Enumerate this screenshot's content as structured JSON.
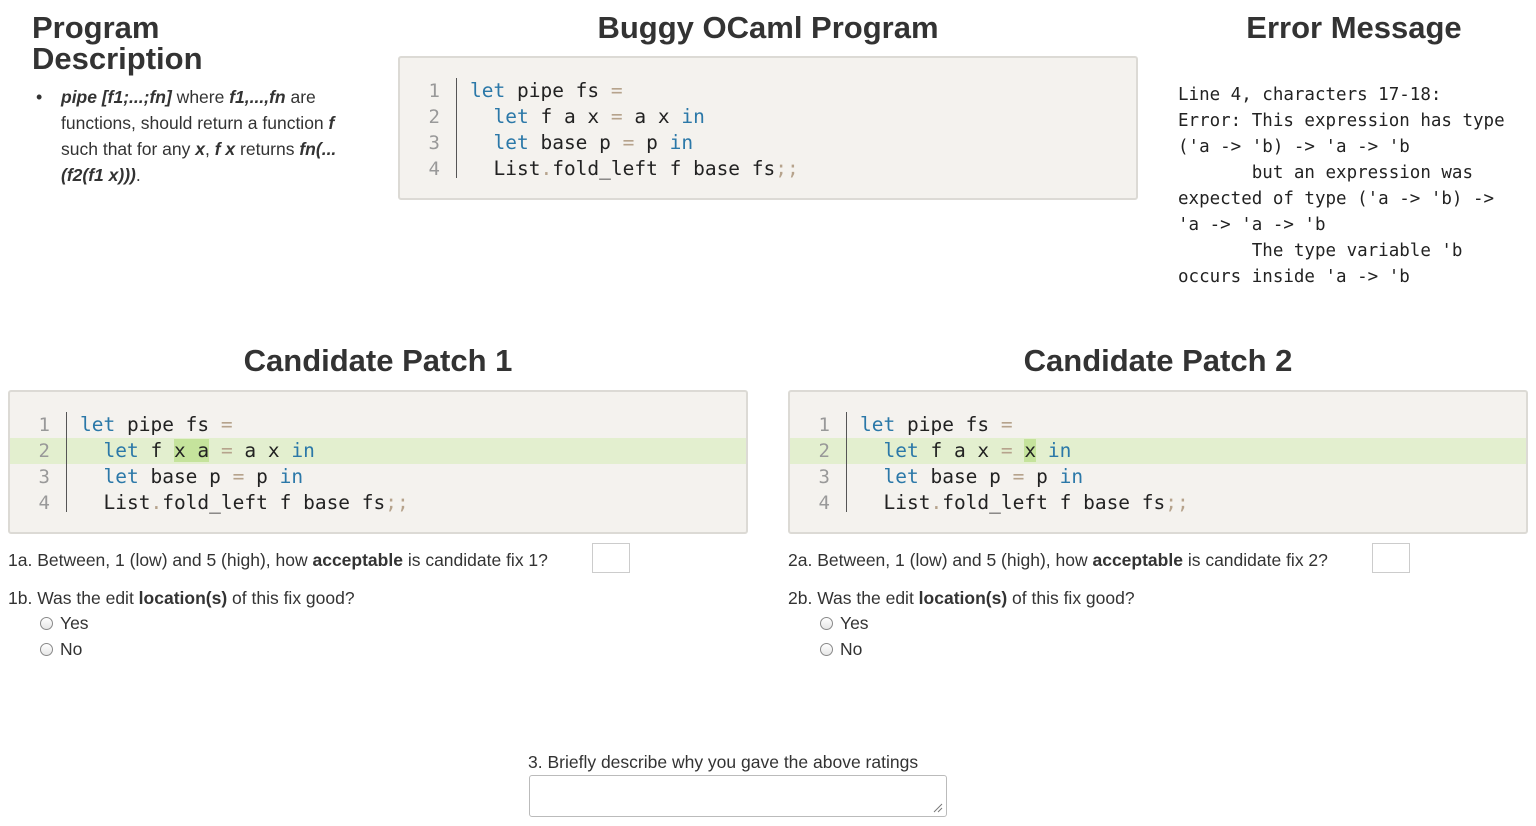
{
  "headings": {
    "description": "Program Description",
    "buggy": "Buggy OCaml Program",
    "error": "Error Message",
    "patch1": "Candidate Patch 1",
    "patch2": "Candidate Patch 2"
  },
  "description": {
    "pipe_sig": "pipe [f1;...;fn]",
    "t1": " where ",
    "fs": "f1,...,fn",
    "t2": " are functions, should return a function ",
    "f": "f",
    "t3": " such that for any ",
    "x": "x",
    "t4": ", ",
    "fx": "f x",
    "t5": " returns ",
    "result": "fn(...(f2(f1 x)))",
    "t6": "."
  },
  "buggy_program": {
    "line_numbers": [
      "1",
      "2",
      "3",
      "4"
    ],
    "lines": [
      "let pipe fs =",
      "  let f a x = a x in",
      "  let base p = p in",
      "  List.fold_left f base fs;;"
    ]
  },
  "error_message": "Line 4, characters 17-18:\nError: This expression has type\n('a -> 'b) -> 'a -> 'b\n       but an expression was\nexpected of type ('a -> 'b) ->\n'a -> 'a -> 'b\n       The type variable 'b\noccurs inside 'a -> 'b",
  "patch1": {
    "line_numbers": [
      "1",
      "2",
      "3",
      "4"
    ],
    "lines": [
      "let pipe fs =",
      "  let f x a = a x in",
      "  let base p = p in",
      "  List.fold_left f base fs;;"
    ],
    "highlighted_line": 2
  },
  "patch2": {
    "line_numbers": [
      "1",
      "2",
      "3",
      "4"
    ],
    "lines": [
      "let pipe fs =",
      "  let f a x = x in",
      "  let base p = p in",
      "  List.fold_left f base fs;;"
    ],
    "highlighted_line": 2
  },
  "questions": {
    "q1a_pre": "1a. Between, 1 (low) and 5 (high), how ",
    "q1a_bold": "acceptable",
    "q1a_post": " is candidate fix 1?",
    "q1b_pre": "1b. Was the edit ",
    "q1b_bold": "location(s)",
    "q1b_post": " of this fix good?",
    "q2a_pre": "2a. Between, 1 (low) and 5 (high), how ",
    "q2a_bold": "acceptable",
    "q2a_post": " is candidate fix 2?",
    "q2b_pre": "2b. Was the edit ",
    "q2b_bold": "location(s)",
    "q2b_post": " of this fix good?",
    "yes": "Yes",
    "no": "No",
    "q3": "3. Briefly describe why you gave the above ratings"
  },
  "colors": {
    "keyword": "#2b78a8",
    "operator": "#b6a38c",
    "highlight_line": "#e3efcf",
    "highlight_token": "#c5e39c",
    "code_bg": "#f4f2ee"
  }
}
